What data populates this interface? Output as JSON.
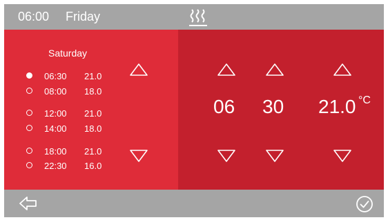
{
  "header": {
    "time": "06:00",
    "day": "Friday",
    "icon": "heating-icon"
  },
  "schedule": {
    "day": "Saturday",
    "entries": [
      {
        "time": "06:30",
        "temp": "21.0",
        "selected": true
      },
      {
        "time": "08:00",
        "temp": "18.0",
        "selected": false
      },
      {
        "time": "12:00",
        "temp": "21.0",
        "selected": false
      },
      {
        "time": "14:00",
        "temp": "18.0",
        "selected": false
      },
      {
        "time": "18:00",
        "temp": "21.0",
        "selected": false
      },
      {
        "time": "22:30",
        "temp": "16.0",
        "selected": false
      }
    ]
  },
  "editor": {
    "hour": "06",
    "minute": "30",
    "temperature": "21.0",
    "unit": "°C"
  },
  "footer": {
    "back_icon": "back-arrow-icon",
    "confirm_icon": "check-circle-icon"
  },
  "colors": {
    "bar": "#a5a5a5",
    "left_panel": "#df2c39",
    "right_panel": "#c3202d",
    "text": "#ffffff"
  }
}
